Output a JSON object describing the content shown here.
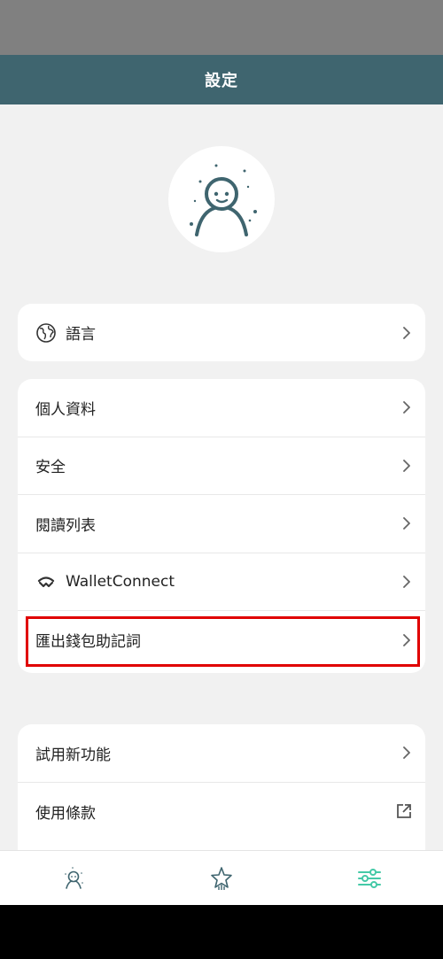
{
  "header": {
    "title": "設定"
  },
  "avatar": {
    "icon": "person-avatar-icon"
  },
  "language_card": {
    "label": "語言",
    "icon": "globe-icon"
  },
  "main_card": {
    "items": [
      {
        "label": "個人資料"
      },
      {
        "label": "安全"
      },
      {
        "label": "閱讀列表"
      },
      {
        "label": "WalletConnect",
        "icon": "walletconnect-icon"
      },
      {
        "label": "匯出錢包助記詞"
      }
    ]
  },
  "extra_card": {
    "items": [
      {
        "label": "試用新功能"
      },
      {
        "label": "使用條款",
        "icon": "external-link-icon"
      }
    ]
  },
  "bottom_nav": {
    "items": [
      {
        "name": "profile-tab",
        "icon": "person-icon"
      },
      {
        "name": "favorites-tab",
        "icon": "star-icon"
      },
      {
        "name": "settings-tab",
        "icon": "sliders-icon",
        "active": true
      }
    ]
  },
  "colors": {
    "header": "#3f656f",
    "accent": "#45c9a7",
    "highlight": "#e00000",
    "background": "#f1f1f1"
  }
}
